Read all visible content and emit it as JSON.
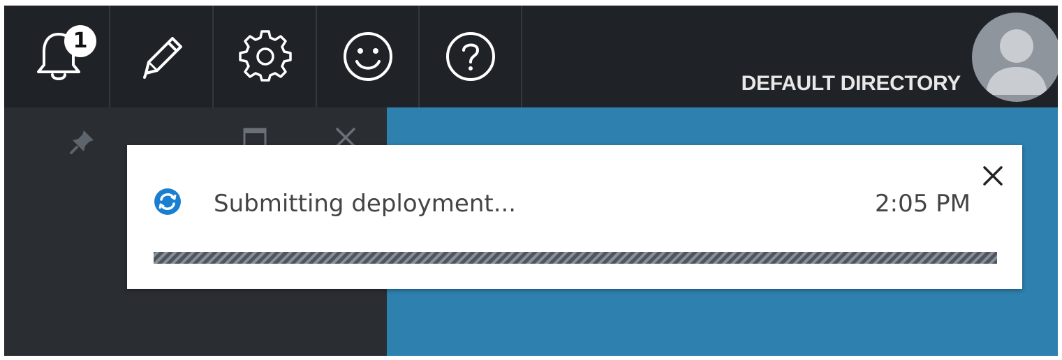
{
  "topbar": {
    "notifications": {
      "icon": "bell-icon",
      "badge_count": "1"
    },
    "edit": {
      "icon": "pencil-icon"
    },
    "settings": {
      "icon": "gear-icon"
    },
    "feedback": {
      "icon": "smiley-icon"
    },
    "help": {
      "icon": "question-circle-icon"
    },
    "directory_label": "DEFAULT DIRECTORY",
    "avatar": {
      "icon": "user-avatar-icon"
    }
  },
  "pane": {
    "pin": {
      "icon": "pin-icon"
    },
    "maximize": {
      "icon": "maximize-icon"
    },
    "close": {
      "icon": "close-icon"
    }
  },
  "notification_toast": {
    "status_icon": "sync-icon",
    "message": "Submitting deployment...",
    "time": "2:05 PM",
    "close_icon": "close-icon",
    "progress": "indeterminate"
  },
  "colors": {
    "topbar_bg": "#1f2226",
    "left_pane_bg": "#2a2e33",
    "right_pane_bg": "#2e80ae",
    "accent_blue": "#0078d4",
    "toast_bg": "#ffffff"
  }
}
